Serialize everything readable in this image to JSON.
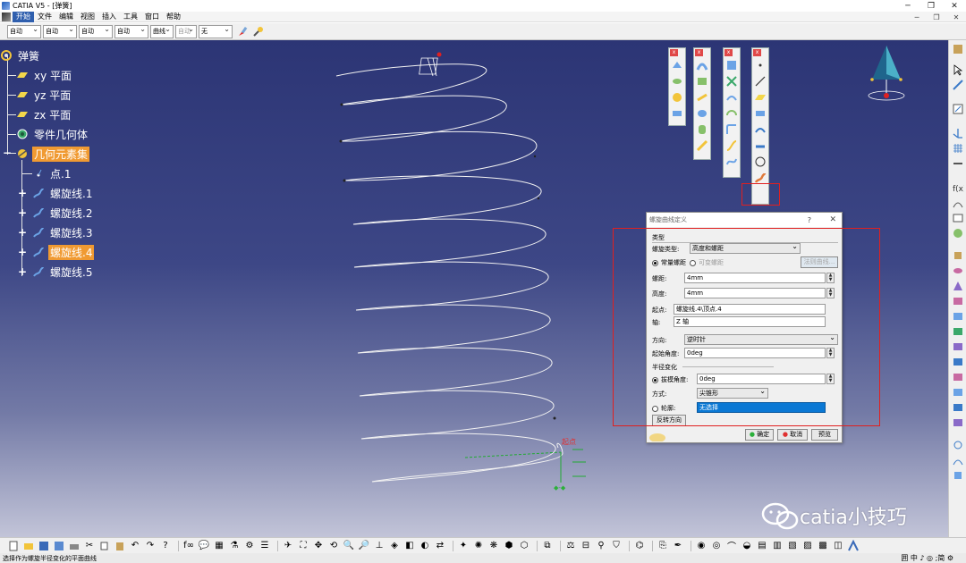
{
  "window": {
    "title": "CATIA V5 - [弹簧]",
    "minimize": "─",
    "maximize": "❐",
    "close": "✕"
  },
  "menubar": {
    "items": [
      "开始",
      "文件",
      "编辑",
      "视图",
      "插入",
      "工具",
      "窗口",
      "帮助"
    ],
    "mdi": [
      "─",
      "❐",
      "✕"
    ]
  },
  "dropdowns": [
    "自动",
    "自动",
    "自动",
    "自动",
    "曲线",
    "自动",
    "无"
  ],
  "tree": {
    "root": "弹簧",
    "planes": [
      "xy 平面",
      "yz 平面",
      "zx 平面"
    ],
    "part_body": "零件几何体",
    "geo_set": "几何元素集",
    "children": [
      "点.1",
      "螺旋线.1",
      "螺旋线.2",
      "螺旋线.3",
      "螺旋线.4",
      "螺旋线.5"
    ]
  },
  "annotation": {
    "start_label": "起点"
  },
  "dialog": {
    "title": "螺旋曲线定义",
    "help": "?",
    "close": "✕",
    "type_group": "类型",
    "helix_type_label": "螺旋类型:",
    "helix_type_value": "高度和螺距",
    "constant_pitch": "常量螺距",
    "variable_pitch": "可变螺距",
    "law_button": "法则曲线...",
    "pitch_label": "螺距:",
    "pitch_value": "4mm",
    "height_label": "高度:",
    "height_value": "4mm",
    "start_label": "起点:",
    "start_value": "螺旋线.4\\顶点.4",
    "axis_label": "轴:",
    "axis_value": "Z 轴",
    "direction_label": "方向:",
    "direction_value": "逆时针",
    "start_angle_label": "起始角度:",
    "start_angle_value": "0deg",
    "radius_group": "半径变化",
    "taper_label": "拔模角度:",
    "taper_value": "0deg",
    "way_label": "方式:",
    "way_value": "尖锥形",
    "profile_label": "轮廓:",
    "profile_value": "无选择",
    "reverse_button": "反转方向",
    "ok_button": "确定",
    "cancel_button": "取消",
    "preview_button": "预览"
  },
  "watermark": "catia小技巧",
  "status": {
    "text": "选择作为螺旋半径变化的平面曲线",
    "ime": "囲 中 ♪ ◎ ;简 ⚙"
  },
  "colors": {
    "viewport_top": "#2c3575",
    "selection": "#f09a32",
    "redbox": "#e02020",
    "dialog_blue": "#0a78d4"
  }
}
